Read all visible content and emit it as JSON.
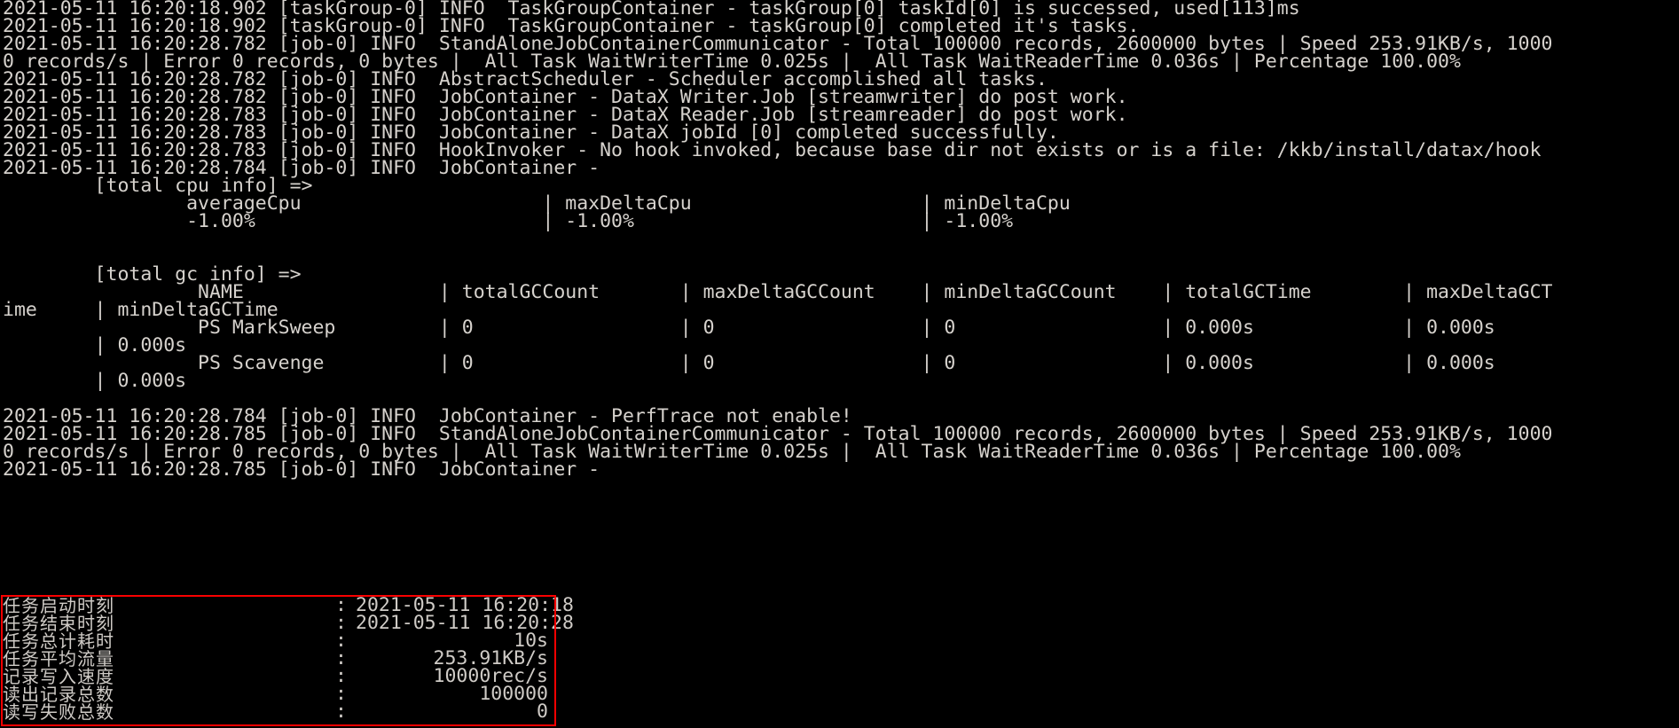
{
  "terminal": {
    "background_color": "#000000",
    "text_color": "#d6d2cd",
    "highlight_border_color": "#f90000",
    "lines": [
      "2021-05-11 16:20:18.902 [taskGroup-0] INFO  TaskGroupContainer - taskGroup[0] taskId[0] is successed, used[113]ms",
      "2021-05-11 16:20:18.902 [taskGroup-0] INFO  TaskGroupContainer - taskGroup[0] completed it's tasks.",
      "2021-05-11 16:20:28.782 [job-0] INFO  StandAloneJobContainerCommunicator - Total 100000 records, 2600000 bytes | Speed 253.91KB/s, 1000",
      "0 records/s | Error 0 records, 0 bytes |  All Task WaitWriterTime 0.025s |  All Task WaitReaderTime 0.036s | Percentage 100.00%",
      "2021-05-11 16:20:28.782 [job-0] INFO  AbstractScheduler - Scheduler accomplished all tasks.",
      "2021-05-11 16:20:28.782 [job-0] INFO  JobContainer - DataX Writer.Job [streamwriter] do post work.",
      "2021-05-11 16:20:28.783 [job-0] INFO  JobContainer - DataX Reader.Job [streamreader] do post work.",
      "2021-05-11 16:20:28.783 [job-0] INFO  JobContainer - DataX jobId [0] completed successfully.",
      "2021-05-11 16:20:28.783 [job-0] INFO  HookInvoker - No hook invoked, because base dir not exists or is a file: /kkb/install/datax/hook",
      "2021-05-11 16:20:28.784 [job-0] INFO  JobContainer - ",
      "        [total cpu info] => ",
      "                averageCpu                     | maxDeltaCpu                    | minDeltaCpu                    ",
      "                -1.00%                         | -1.00%                         | -1.00%                         ",
      "",
      "",
      "        [total gc info] => ",
      "                 NAME                 | totalGCCount       | maxDeltaGCCount    | minDeltaGCCount    | totalGCTime        | maxDeltaGCT",
      "ime     | minDeltaGCTime     ",
      "                 PS MarkSweep         | 0                  | 0                  | 0                  | 0.000s             | 0.000s     ",
      "        | 0.000s             ",
      "                 PS Scavenge          | 0                  | 0                  | 0                  | 0.000s             | 0.000s     ",
      "        | 0.000s             ",
      "",
      "2021-05-11 16:20:28.784 [job-0] INFO  JobContainer - PerfTrace not enable!",
      "2021-05-11 16:20:28.785 [job-0] INFO  StandAloneJobContainerCommunicator - Total 100000 records, 2600000 bytes | Speed 253.91KB/s, 1000",
      "0 records/s | Error 0 records, 0 bytes |  All Task WaitWriterTime 0.025s |  All Task WaitReaderTime 0.036s | Percentage 100.00%",
      "2021-05-11 16:20:28.785 [job-0] INFO  JobContainer - "
    ],
    "summary": {
      "rows": [
        {
          "label": "任务启动时刻",
          "separator": ":",
          "value": "2021-05-11 16:20:18",
          "align": "left"
        },
        {
          "label": "任务结束时刻",
          "separator": ":",
          "value": "2021-05-11 16:20:28",
          "align": "left"
        },
        {
          "label": "任务总计耗时",
          "separator": ":",
          "value": "10s",
          "align": "right"
        },
        {
          "label": "任务平均流量",
          "separator": ":",
          "value": "253.91KB/s",
          "align": "right"
        },
        {
          "label": "记录写入速度",
          "separator": ":",
          "value": "10000rec/s",
          "align": "right"
        },
        {
          "label": "读出记录总数",
          "separator": ":",
          "value": "100000",
          "align": "right"
        },
        {
          "label": "读写失败总数",
          "separator": ":",
          "value": "0",
          "align": "right"
        }
      ]
    }
  }
}
